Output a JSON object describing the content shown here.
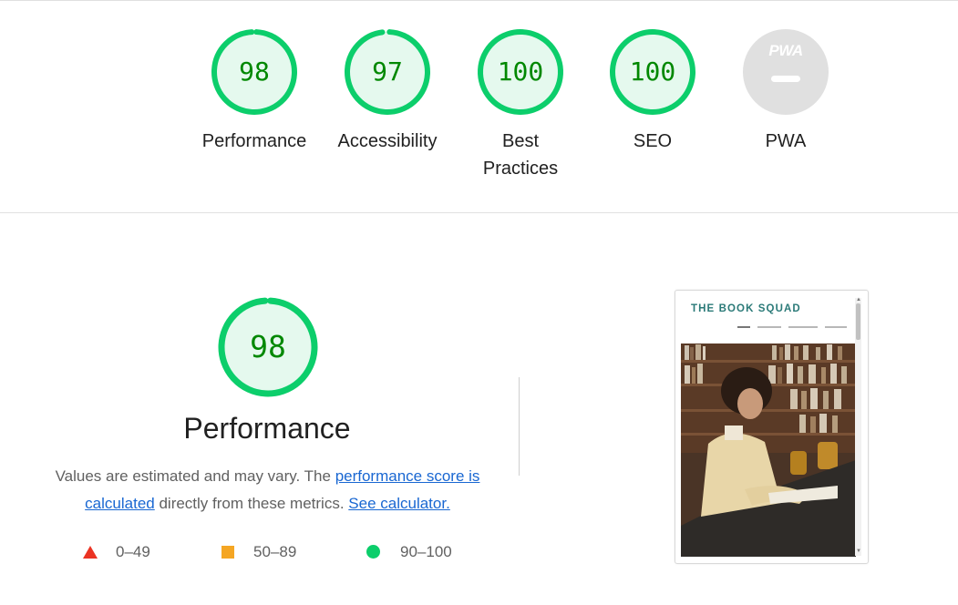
{
  "categories": [
    {
      "label": "Performance",
      "score": "98",
      "score_value": 98
    },
    {
      "label": "Accessibility",
      "score": "97",
      "score_value": 97
    },
    {
      "label": "Best Practices",
      "score": "100",
      "score_value": 100
    },
    {
      "label": "SEO",
      "score": "100",
      "score_value": 100
    },
    {
      "label": "PWA",
      "score": "",
      "badge_text": "PWA"
    }
  ],
  "performance": {
    "score": "98",
    "score_value": 98,
    "title": "Performance",
    "desc_part1": "Values are estimated and may vary. The ",
    "link_score": "performance score is calculated",
    "desc_part2": " directly from these metrics. ",
    "link_calculator": "See calculator."
  },
  "legend": [
    {
      "range": "0–49",
      "shape": "triangle-icon",
      "color": "#eb3323"
    },
    {
      "range": "50–89",
      "shape": "square-icon",
      "color": "#f5a623"
    },
    {
      "range": "90–100",
      "shape": "circle-icon",
      "color": "#0cce6b"
    }
  ],
  "screenshot": {
    "site_title": "THE BOOK SQUAD"
  },
  "colors": {
    "pass_green": "#0cce6b",
    "pass_fill": "#e5f9ee",
    "pass_text": "#008800",
    "link": "#1967d2",
    "pwa_gray": "#e0e0e0"
  }
}
